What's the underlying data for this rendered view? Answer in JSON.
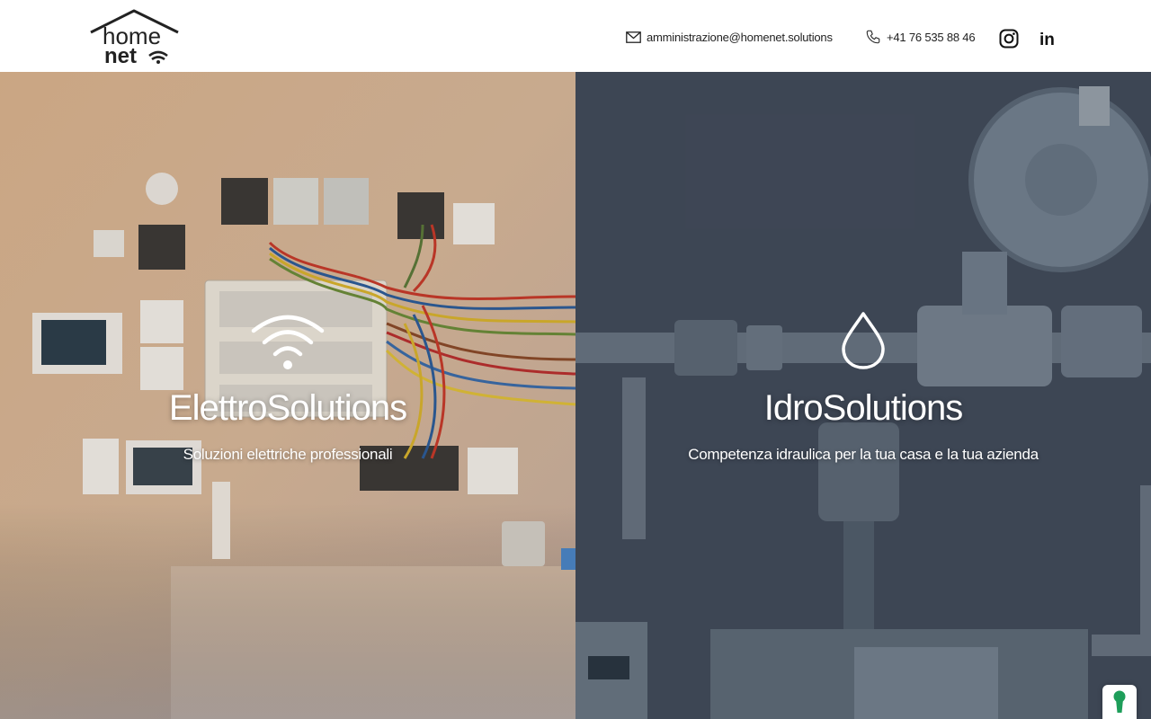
{
  "brand": {
    "logo_word_1": "home",
    "logo_word_2": "net"
  },
  "header": {
    "email": "amministrazione@homenet.solutions",
    "phone": "+41 76 535 88 46",
    "social": [
      {
        "icon": "instagram-icon"
      },
      {
        "icon": "linkedin-icon",
        "glyph": "in"
      }
    ]
  },
  "panels": [
    {
      "icon": "wifi-icon",
      "title": "ElettroSolutions",
      "subtitle": "Soluzioni elettriche professionali"
    },
    {
      "icon": "water-drop-icon",
      "title": "IdroSolutions",
      "subtitle": "Competenza idraulica per la tua casa e la tua azienda"
    }
  ],
  "cookie_button": {
    "icon": "keyhole-icon",
    "color": "#1e9e5a"
  },
  "colors": {
    "text_dark": "#222222",
    "header_bg": "#ffffff",
    "panel_text": "#ffffff"
  }
}
